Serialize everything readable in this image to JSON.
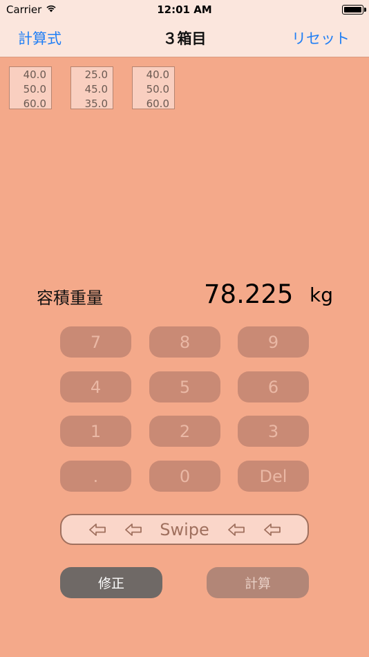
{
  "status": {
    "carrier": "Carrier",
    "time": "12:01 AM"
  },
  "nav": {
    "left": "計算式",
    "title": "３箱目",
    "right": "リセット"
  },
  "boxes": [
    {
      "values": [
        "40.0",
        "50.0",
        "60.0"
      ]
    },
    {
      "values": [
        "25.0",
        "45.0",
        "35.0"
      ]
    },
    {
      "values": [
        "40.0",
        "50.0",
        "60.0"
      ]
    }
  ],
  "result": {
    "label": "容積重量",
    "value": "78.225",
    "unit": "kg"
  },
  "keypad": {
    "keys": [
      "7",
      "8",
      "9",
      "4",
      "5",
      "6",
      "1",
      "2",
      "3",
      ".",
      "0",
      "Del"
    ]
  },
  "swipe": {
    "label": "Swipe"
  },
  "buttons": {
    "fix": "修正",
    "calc": "計算"
  },
  "colors": {
    "background": "#f4a98a",
    "bar": "#fbe6dd",
    "accent": "#1f7ef5"
  }
}
